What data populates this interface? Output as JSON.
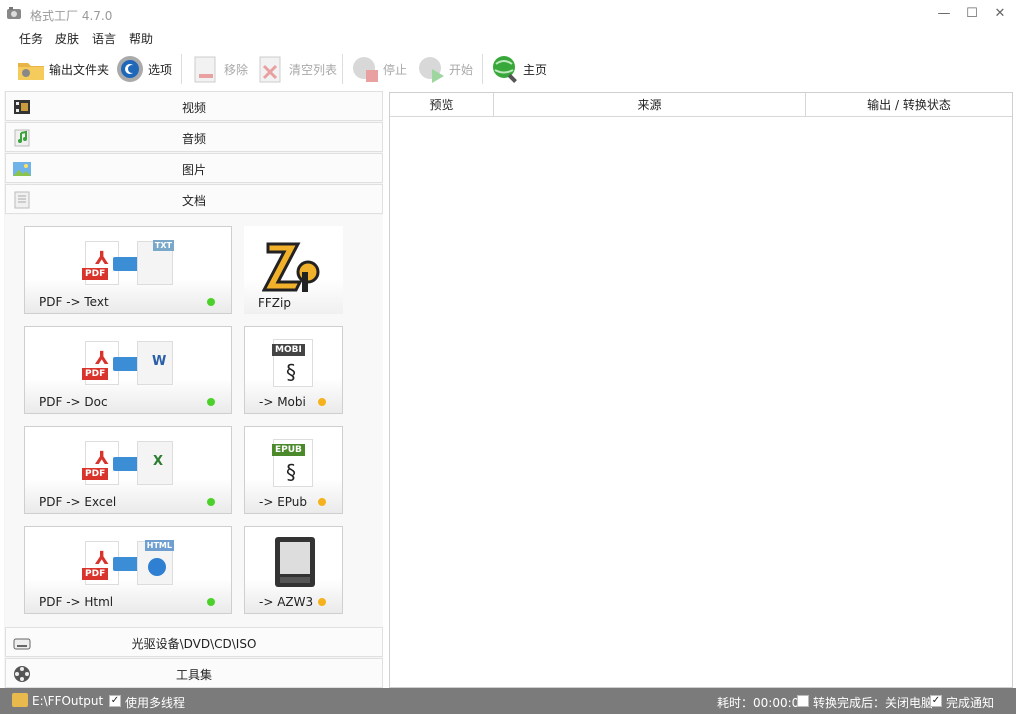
{
  "window": {
    "title": "格式工厂 4.7.0",
    "minimize": "—",
    "maximize": "☐",
    "close": "✕"
  },
  "menu": [
    "任务",
    "皮肤",
    "语言",
    "帮助"
  ],
  "toolbar": {
    "output_folder": "输出文件夹",
    "options": "选项",
    "remove": "移除",
    "clear_list": "清空列表",
    "stop": "停止",
    "start": "开始",
    "home": "主页"
  },
  "categories": {
    "video": "视频",
    "audio": "音频",
    "image": "图片",
    "document": "文档",
    "optical": "光驱设备\\DVD\\CD\\ISO",
    "tools": "工具集"
  },
  "tiles": [
    {
      "label": "PDF -> Text",
      "tag": "TXT",
      "status": "green"
    },
    {
      "label": "FFZip",
      "status": "none"
    },
    {
      "label": "PDF -> Doc",
      "tag": "W",
      "status": "green"
    },
    {
      "label": "-> Mobi",
      "tag": "MOBI",
      "status": "orange"
    },
    {
      "label": "PDF -> Excel",
      "tag": "X",
      "status": "green"
    },
    {
      "label": "-> EPub",
      "tag": "EPUB",
      "status": "orange"
    },
    {
      "label": "PDF -> Html",
      "tag": "HTML",
      "status": "green"
    },
    {
      "label": "-> AZW3",
      "status": "orange"
    }
  ],
  "pdf_tag": "PDF",
  "table": {
    "columns": [
      "预览",
      "来源",
      "输出 / 转换状态"
    ]
  },
  "status": {
    "path": "E:\\FFOutput",
    "multithread": "使用多线程",
    "elapsed": "耗时：00:00:00",
    "after_done": "转换完成后：关闭电脑",
    "notify": "完成通知"
  },
  "colors": {
    "green": "#4cd12a",
    "orange": "#f5b21c",
    "accent": "#3b8ed6",
    "pdf_red": "#d9342b"
  }
}
